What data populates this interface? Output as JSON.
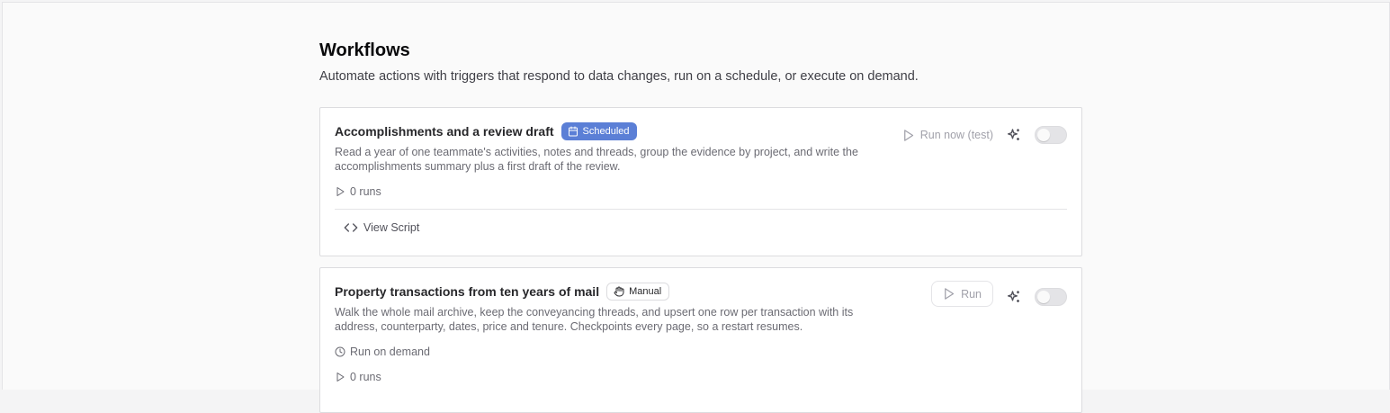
{
  "page": {
    "title": "Workflows",
    "subtitle": "Automate actions with triggers that respond to data changes, run on a schedule, or execute on demand."
  },
  "workflows": [
    {
      "title": "Accomplishments and a review draft",
      "badge": "Scheduled",
      "badge_icon": "calendar-icon",
      "description": "Read a year of one teammate's activities, notes and threads, group the evidence by project, and write the accomplishments summary plus a first draft of the review.",
      "runs": "0 runs",
      "run_button": "Run now (test)",
      "view_script": "View Script",
      "enabled": false
    },
    {
      "title": "Property transactions from ten years of mail",
      "badge": "Manual",
      "badge_icon": "hand-icon",
      "description": "Walk the whole mail archive, keep the conveyancing threads, and upsert one row per transaction with its address, counterparty, dates, price and tenure. Checkpoints every page, so a restart resumes.",
      "trigger": "Run on demand",
      "runs": "0 runs",
      "run_button": "Run",
      "enabled": false
    }
  ],
  "colors": {
    "scheduled_badge": "#5b7fd6",
    "text_muted": "#6b6b73",
    "border": "#dcdcdf"
  }
}
